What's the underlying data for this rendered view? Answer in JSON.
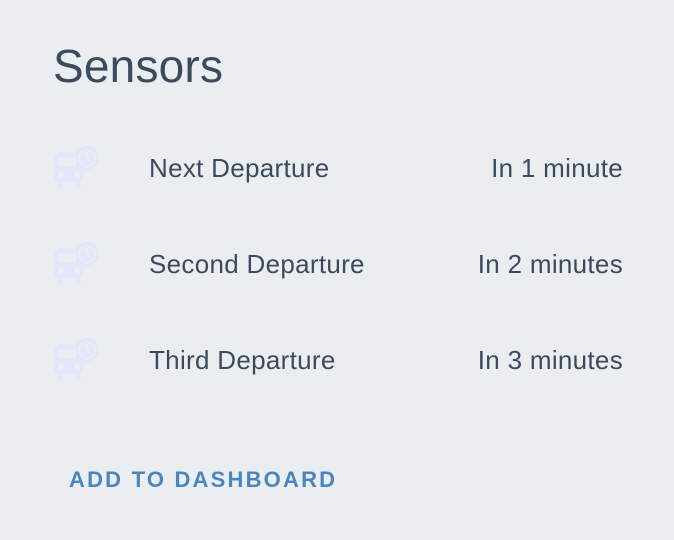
{
  "card": {
    "title": "Sensors",
    "rows": [
      {
        "icon": "bus-clock-icon",
        "label": "Next Departure",
        "value": "In 1 minute"
      },
      {
        "icon": "bus-clock-icon",
        "label": "Second Departure",
        "value": "In 2 minutes"
      },
      {
        "icon": "bus-clock-icon",
        "label": "Third Departure",
        "value": "In 3 minutes"
      }
    ],
    "action_label": "ADD TO DASHBOARD"
  },
  "colors": {
    "background": "#ebeef0",
    "text": "#3c4a5e",
    "icon": "#e3e7fb",
    "accent": "#4a86bd"
  }
}
